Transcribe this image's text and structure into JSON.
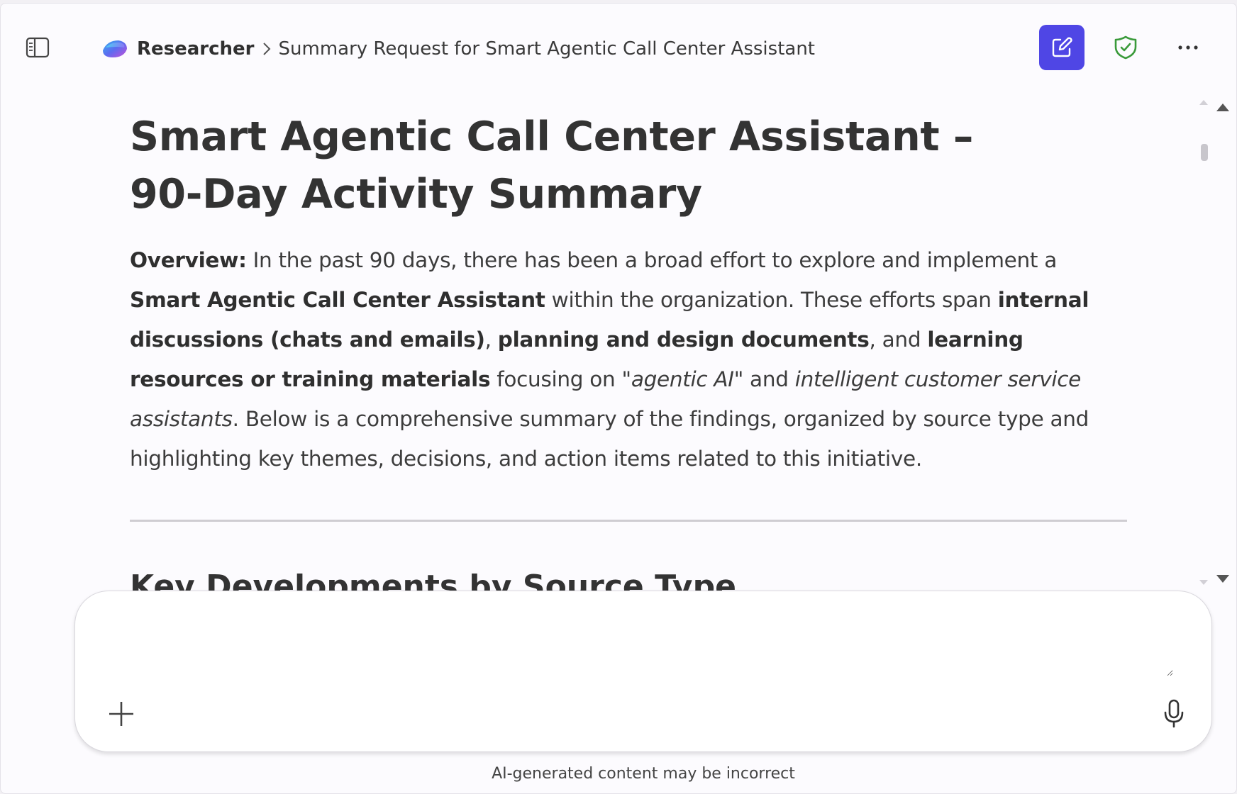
{
  "header": {
    "app_name": "Researcher",
    "breadcrumb_separator": ">",
    "current_page": "Summary Request for Smart Agentic Call Center Assistant",
    "icons": {
      "sidebar": "sidebar-toggle-icon",
      "logo": "researcher-logo-icon",
      "new_chat": "compose-icon",
      "shield": "shield-check-icon",
      "more": "more-horizontal-icon"
    }
  },
  "document": {
    "title": "Smart Agentic Call Center Assistant – 90-Day Activity Summary",
    "overview": {
      "label": "Overview:",
      "t1": " In the past 90 days, there has been a broad effort to explore and implement a ",
      "b1": "Smart Agentic Call Center Assistant",
      "t2": " within the organization. These efforts span ",
      "b2": "internal discussions (chats and emails)",
      "t3": ", ",
      "b3": "planning and design documents",
      "t4": ", and ",
      "b4": "learning resources or training materials",
      "t5": " focusing on ",
      "i1": "\"agentic AI\"",
      "t6": " and ",
      "i2": "intelligent customer service assistants",
      "t7": ". Below is a comprehensive summary of the findings, organized by source type and highlighting key themes, decisions, and action items related to this initiative."
    },
    "section_heading": "Key Developments by Source Type"
  },
  "composer": {
    "placeholder": "",
    "value": ""
  },
  "footer": {
    "disclaimer": "AI-generated content may be incorrect"
  },
  "colors": {
    "accent": "#4f46e5",
    "shield_green": "#3a9a3a",
    "background": "#fcfbfe"
  }
}
